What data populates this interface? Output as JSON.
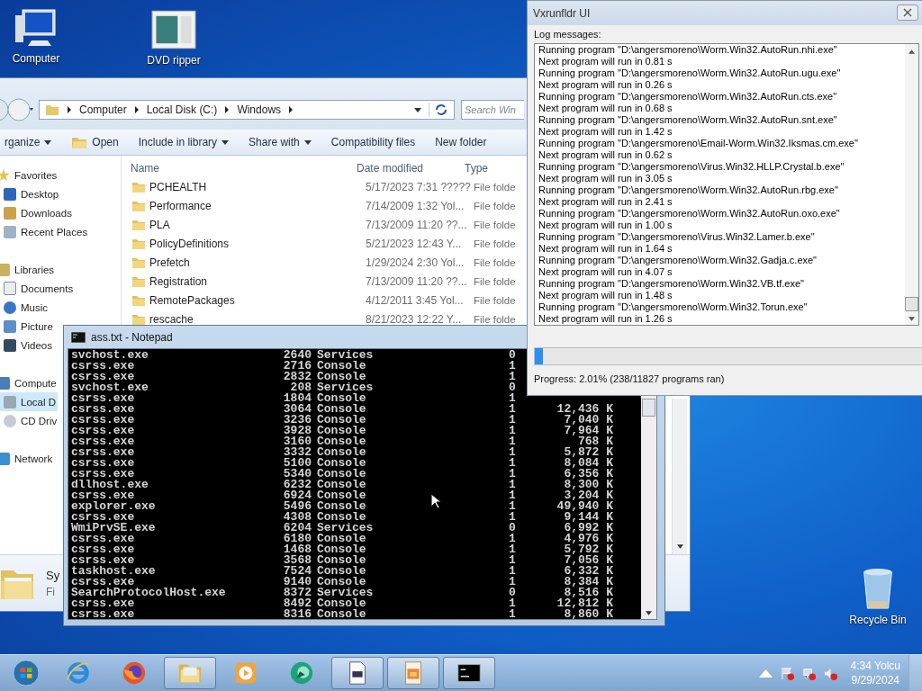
{
  "desktop_icons": [
    {
      "label": "Computer",
      "kind": "computer"
    },
    {
      "label": "DVD ripper",
      "kind": "app"
    },
    {
      "label": "Recycle Bin",
      "kind": "bin"
    }
  ],
  "explorer": {
    "breadcrumbs": [
      "Computer",
      "Local Disk (C:)",
      "Windows"
    ],
    "search": {
      "placeholder": "Search Win"
    },
    "toolbar": [
      {
        "label": "rganize",
        "dropdown": true,
        "icon": false
      },
      {
        "label": "Open",
        "dropdown": false,
        "icon": true
      },
      {
        "label": "Include in library",
        "dropdown": true,
        "icon": false
      },
      {
        "label": "Share with",
        "dropdown": true,
        "icon": false
      },
      {
        "label": "Compatibility files",
        "dropdown": false,
        "icon": false
      },
      {
        "label": "New folder",
        "dropdown": false,
        "icon": false
      }
    ],
    "sidebar": [
      {
        "label": "Favorites",
        "kind": "star",
        "selected": false,
        "children": [
          {
            "label": "Desktop",
            "kind": "desktop",
            "selected": false
          },
          {
            "label": "Downloads",
            "kind": "downloads",
            "selected": false
          },
          {
            "label": "Recent Places",
            "kind": "recent",
            "selected": false
          }
        ]
      },
      {
        "label": "Libraries",
        "kind": "library",
        "selected": false,
        "children": [
          {
            "label": "Documents",
            "kind": "documents",
            "selected": false
          },
          {
            "label": "Music",
            "kind": "music",
            "selected": false
          },
          {
            "label": "Picture",
            "kind": "pictures",
            "selected": false
          },
          {
            "label": "Videos",
            "kind": "videos",
            "selected": false
          }
        ]
      },
      {
        "label": "Compute",
        "kind": "computer",
        "selected": false,
        "children": [
          {
            "label": "Local D",
            "kind": "disk",
            "selected": true
          },
          {
            "label": "CD Driv",
            "kind": "cd",
            "selected": false
          }
        ]
      },
      {
        "label": "Network",
        "kind": "network",
        "selected": false
      }
    ],
    "columns": [
      "Name",
      "Date modified",
      "Type"
    ],
    "rows": [
      {
        "name": "PCHEALTH",
        "date": "5/17/2023 7:31 ?????",
        "type": "File folde"
      },
      {
        "name": "Performance",
        "date": "7/14/2009 1:32 Yol...",
        "type": "File folde"
      },
      {
        "name": "PLA",
        "date": "7/13/2009 11:20 ??...",
        "type": "File folde"
      },
      {
        "name": "PolicyDefinitions",
        "date": "5/21/2023 12:43 Y...",
        "type": "File folde"
      },
      {
        "name": "Prefetch",
        "date": "1/29/2024 2:30 Yol...",
        "type": "File folde"
      },
      {
        "name": "Registration",
        "date": "7/13/2009 11:20 ??...",
        "type": "File folde"
      },
      {
        "name": "RemotePackages",
        "date": "4/12/2011 3:45 Yol...",
        "type": "File folde"
      },
      {
        "name": "rescache",
        "date": "8/21/2023 12:22 Y...",
        "type": "File folde"
      }
    ],
    "details_pane": {
      "name": "Sy",
      "type": "Fi"
    }
  },
  "notepad": {
    "title": "ass.txt - Notepad",
    "rows": [
      {
        "image": "svchost.exe",
        "pid": "2640",
        "session_name": "Services",
        "session": "0"
      },
      {
        "image": "csrss.exe",
        "pid": "2716",
        "session_name": "Console",
        "session": "1"
      },
      {
        "image": "csrss.exe",
        "pid": "2832",
        "session_name": "Console",
        "session": "1"
      },
      {
        "image": "svchost.exe",
        "pid": "208",
        "session_name": "Services",
        "session": "0"
      },
      {
        "image": "csrss.exe",
        "pid": "1804",
        "session_name": "Console",
        "session": "1"
      },
      {
        "image": "csrss.exe",
        "pid": "3064",
        "session_name": "Console",
        "session": "1",
        "mem": "12,436 K"
      },
      {
        "image": "csrss.exe",
        "pid": "3236",
        "session_name": "Console",
        "session": "1",
        "mem": "7,040 K"
      },
      {
        "image": "csrss.exe",
        "pid": "3928",
        "session_name": "Console",
        "session": "1",
        "mem": "7,964 K"
      },
      {
        "image": "csrss.exe",
        "pid": "3160",
        "session_name": "Console",
        "session": "1",
        "mem": "768 K"
      },
      {
        "image": "csrss.exe",
        "pid": "3332",
        "session_name": "Console",
        "session": "1",
        "mem": "5,872 K"
      },
      {
        "image": "csrss.exe",
        "pid": "5100",
        "session_name": "Console",
        "session": "1",
        "mem": "8,084 K"
      },
      {
        "image": "csrss.exe",
        "pid": "5340",
        "session_name": "Console",
        "session": "1",
        "mem": "6,356 K"
      },
      {
        "image": "dllhost.exe",
        "pid": "6232",
        "session_name": "Console",
        "session": "1",
        "mem": "8,300 K"
      },
      {
        "image": "csrss.exe",
        "pid": "6924",
        "session_name": "Console",
        "session": "1",
        "mem": "3,204 K"
      },
      {
        "image": "explorer.exe",
        "pid": "5496",
        "session_name": "Console",
        "session": "1",
        "mem": "49,940 K"
      },
      {
        "image": "csrss.exe",
        "pid": "4308",
        "session_name": "Console",
        "session": "1",
        "mem": "9,144 K"
      },
      {
        "image": "WmiPrvSE.exe",
        "pid": "6204",
        "session_name": "Services",
        "session": "0",
        "mem": "6,992 K"
      },
      {
        "image": "csrss.exe",
        "pid": "6180",
        "session_name": "Console",
        "session": "1",
        "mem": "4,976 K"
      },
      {
        "image": "csrss.exe",
        "pid": "1468",
        "session_name": "Console",
        "session": "1",
        "mem": "5,792 K"
      },
      {
        "image": "csrss.exe",
        "pid": "3568",
        "session_name": "Console",
        "session": "1",
        "mem": "7,056 K"
      },
      {
        "image": "taskhost.exe",
        "pid": "7524",
        "session_name": "Console",
        "session": "1",
        "mem": "6,332 K"
      },
      {
        "image": "csrss.exe",
        "pid": "9140",
        "session_name": "Console",
        "session": "1",
        "mem": "8,384 K"
      },
      {
        "image": "SearchProtocolHost.exe",
        "pid": "8372",
        "session_name": "Services",
        "session": "0",
        "mem": "8,516 K"
      },
      {
        "image": "csrss.exe",
        "pid": "8492",
        "session_name": "Console",
        "session": "1",
        "mem": "12,812 K"
      },
      {
        "image": "csrss.exe",
        "pid": "8316",
        "session_name": "Console",
        "session": "1",
        "mem": "8,860 K"
      }
    ]
  },
  "vx": {
    "title": "Vxrunfldr UI",
    "log_label": "Log messages:",
    "log": [
      "Running program \"D:\\angersmoreno\\Worm.Win32.AutoRun.nhi.exe\"",
      "Next program will run in 0.81 s",
      "Running program \"D:\\angersmoreno\\Worm.Win32.AutoRun.ugu.exe\"",
      "Next program will run in 0.26 s",
      "Running program \"D:\\angersmoreno\\Worm.Win32.AutoRun.cts.exe\"",
      "Next program will run in 0.68 s",
      "Running program \"D:\\angersmoreno\\Worm.Win32.AutoRun.snt.exe\"",
      "Next program will run in 1.42 s",
      "Running program \"D:\\angersmoreno\\Email-Worm.Win32.Iksmas.cm.exe\"",
      "Next program will run in 0.62 s",
      "Running program \"D:\\angersmoreno\\Virus.Win32.HLLP.Crystal.b.exe\"",
      "Next program will run in 3.05 s",
      "Running program \"D:\\angersmoreno\\Worm.Win32.AutoRun.rbg.exe\"",
      "Next program will run in 2.41 s",
      "Running program \"D:\\angersmoreno\\Worm.Win32.AutoRun.oxo.exe\"",
      "Next program will run in 1.00 s",
      "Running program \"D:\\angersmoreno\\Virus.Win32.Lamer.b.exe\"",
      "Next program will run in 1.64 s",
      "Running program \"D:\\angersmoreno\\Worm.Win32.Gadja.c.exe\"",
      "Next program will run in 4.07 s",
      "Running program \"D:\\angersmoreno\\Worm.Win32.VB.tf.exe\"",
      "Next program will run in 1.48 s",
      "Running program \"D:\\angersmoreno\\Worm.Win32.Torun.exe\"",
      "Next program will run in 1.26 s"
    ],
    "progress": {
      "level": 0.0201,
      "text": "Progress: 2.01% (238/11827 programs ran)"
    }
  },
  "taskbar": {
    "items": [
      {
        "kind": "start",
        "open": false
      },
      {
        "kind": "ie",
        "open": false
      },
      {
        "kind": "firefox",
        "open": false
      },
      {
        "kind": "folder",
        "open": true
      },
      {
        "kind": "media",
        "open": false
      },
      {
        "kind": "globe",
        "open": false
      },
      {
        "kind": "document",
        "open": true
      },
      {
        "kind": "paint",
        "open": true
      },
      {
        "kind": "console",
        "open": true
      }
    ],
    "time": "4:34 Yolcu",
    "date": "9/29/2024"
  }
}
